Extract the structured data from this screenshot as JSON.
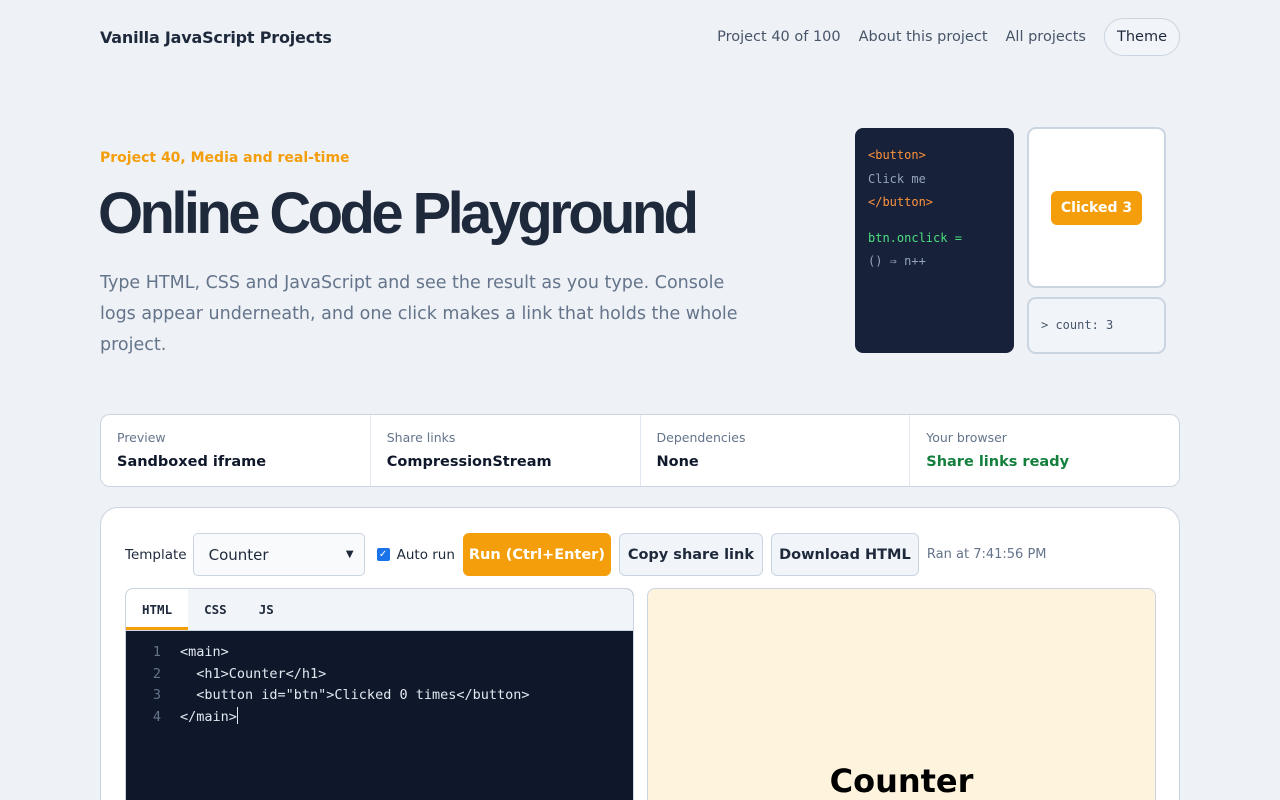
{
  "nav": {
    "brand": "Vanilla JavaScript Projects",
    "links": [
      "Project 40 of 100",
      "About this project",
      "All projects"
    ],
    "theme_label": "Theme"
  },
  "hero": {
    "eyebrow": "Project 40, Media and real-time",
    "title": "Online Code Playground",
    "description": "Type HTML, CSS and JavaScript and see the result as you type. Console logs appear underneath, and one click makes a link that holds the whole project."
  },
  "illustration": {
    "code_lines": [
      "<button>",
      "Click me",
      "</button>",
      "btn.onclick =",
      "() ⇒ n++"
    ],
    "badge": "Clicked 3",
    "console": "> count: 3"
  },
  "info": [
    {
      "label": "Preview",
      "value": "Sandboxed iframe"
    },
    {
      "label": "Share links",
      "value": "CompressionStream"
    },
    {
      "label": "Dependencies",
      "value": "None"
    },
    {
      "label": "Your browser",
      "value": "Share links ready"
    }
  ],
  "toolbar": {
    "template_label": "Template",
    "template_selected": "Counter",
    "auto_run_label": "Auto run",
    "auto_run_checked": true,
    "run_label": "Run (Ctrl+Enter)",
    "share_label": "Copy share link",
    "download_label": "Download HTML",
    "status": "Ran at 7:41:56 PM"
  },
  "editor": {
    "tabs": [
      "HTML",
      "CSS",
      "JS"
    ],
    "active_tab": "HTML",
    "lines": [
      {
        "n": "1",
        "text": "<main>"
      },
      {
        "n": "2",
        "text": "  <h1>Counter</h1>"
      },
      {
        "n": "3",
        "text": "  <button id=\"btn\">Clicked 0 times</button>"
      },
      {
        "n": "4",
        "text": "</main>"
      }
    ]
  },
  "preview": {
    "heading": "Counter"
  },
  "colors": {
    "accent": "#f59e0b",
    "success": "#15803d",
    "code_bg": "#0f172a",
    "preview_bg": "#fef3dc"
  }
}
